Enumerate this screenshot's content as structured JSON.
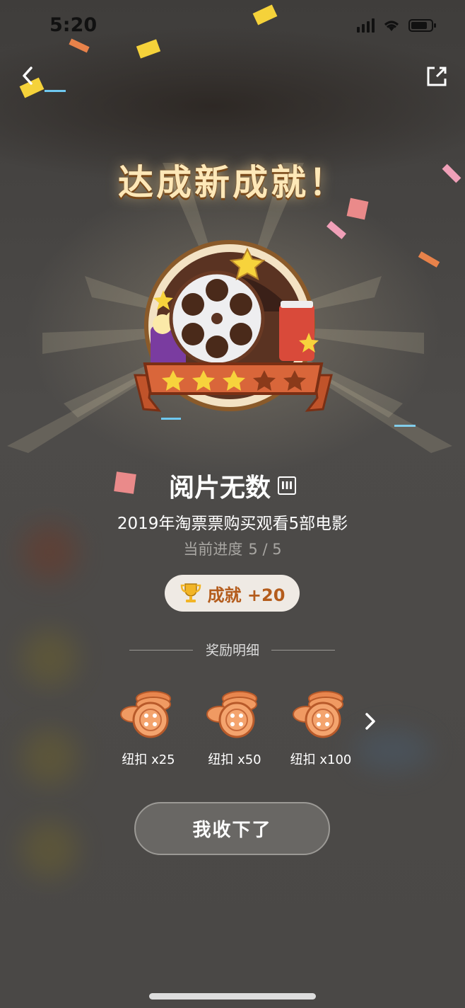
{
  "status": {
    "time": "5:20"
  },
  "headline": "达成新成就！",
  "achievement": {
    "title": "阅片无数",
    "level": "III",
    "description": "2019年淘票票购买观看5部电影",
    "progress_label": "当前进度",
    "progress_value": "5 / 5",
    "stars_total": 5,
    "stars_earned": 3
  },
  "points": {
    "label": "成就 +20"
  },
  "rewards": {
    "title": "奖励明细",
    "items": [
      {
        "label": "纽扣 x25",
        "icon": "button-coins-icon"
      },
      {
        "label": "纽扣 x50",
        "icon": "button-coins-icon"
      },
      {
        "label": "纽扣 x100",
        "icon": "button-coins-icon"
      }
    ]
  },
  "accept_button": "我收下了",
  "colors": {
    "accent": "#b45c1c",
    "headline": "#fde8b8",
    "pill_bg": "#efeae4"
  }
}
